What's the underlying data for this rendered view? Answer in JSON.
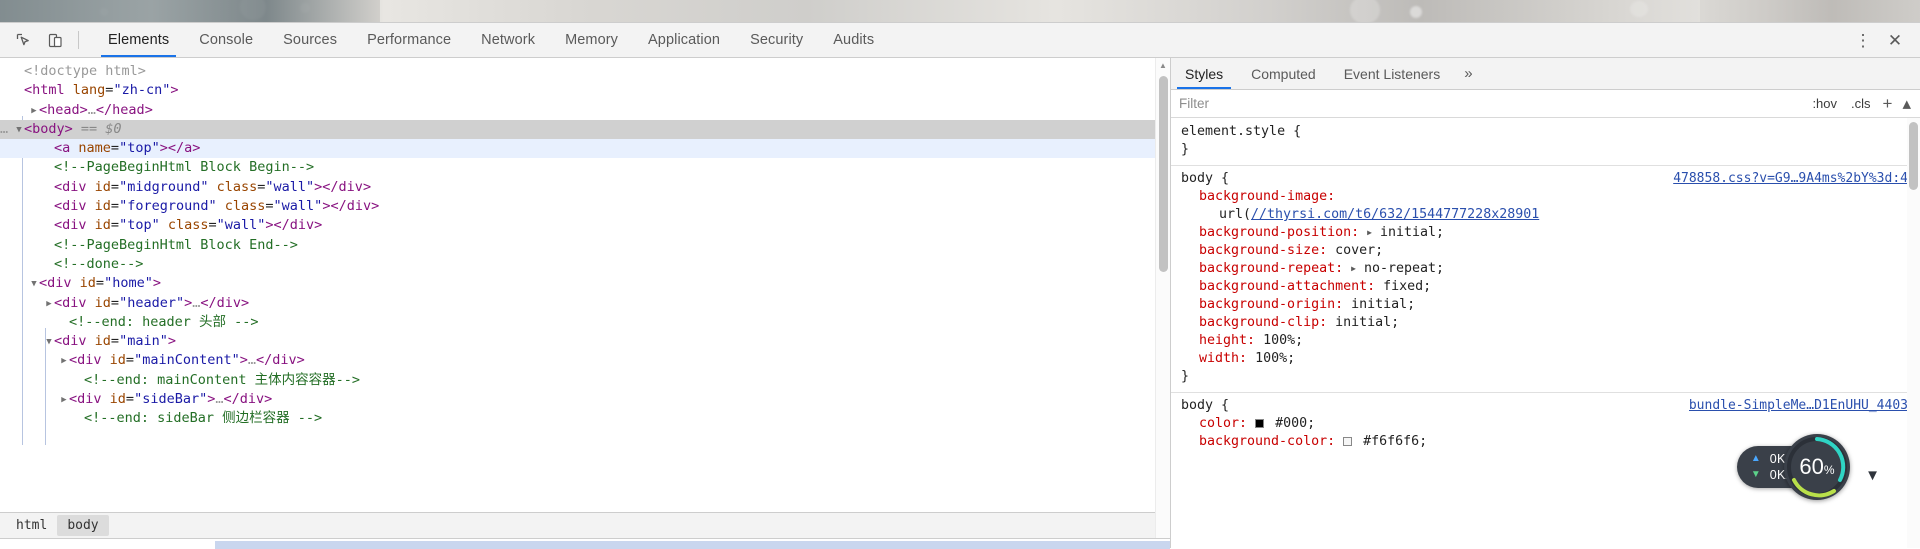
{
  "toolbar": {
    "icons": [
      {
        "name": "inspect-element-icon",
        "label": "Inspect element"
      },
      {
        "name": "device-toolbar-icon",
        "label": "Toggle device toolbar"
      }
    ],
    "tabs": [
      {
        "label": "Elements",
        "active": true
      },
      {
        "label": "Console",
        "active": false
      },
      {
        "label": "Sources",
        "active": false
      },
      {
        "label": "Performance",
        "active": false
      },
      {
        "label": "Network",
        "active": false
      },
      {
        "label": "Memory",
        "active": false
      },
      {
        "label": "Application",
        "active": false
      },
      {
        "label": "Security",
        "active": false
      },
      {
        "label": "Audits",
        "active": false
      }
    ],
    "more_label": "⋮",
    "close_label": "✕"
  },
  "dom": {
    "lines": [
      {
        "indent": 0,
        "tri": "",
        "html": "<span class=\"gray\">&lt;!doctype html&gt;</span>",
        "state": ""
      },
      {
        "indent": 0,
        "tri": "",
        "html": "<span class=\"tag\">&lt;html</span> <span class=\"attr\">lang</span>=<span class=\"val\">\"zh-cn\"</span><span class=\"tag\">&gt;</span>",
        "state": ""
      },
      {
        "indent": 1,
        "tri": "▶",
        "html": "<span class=\"tag\">&lt;head&gt;</span><span class=\"gray\">…</span><span class=\"tag\">&lt;/head&gt;</span>",
        "state": ""
      },
      {
        "indent": 0,
        "tri": "▼",
        "html": "<span class=\"tag\">&lt;body&gt;</span> <span class=\"dollar\">== $0</span>",
        "state": "sel-gray",
        "ellipsis": true
      },
      {
        "indent": 2,
        "tri": "",
        "html": "<span class=\"tag\">&lt;a</span> <span class=\"attr\">name</span>=<span class=\"val\">\"top\"</span><span class=\"tag\">&gt;&lt;/a&gt;</span>",
        "state": "sel-blue"
      },
      {
        "indent": 2,
        "tri": "",
        "html": "<span class=\"cmt\">&lt;!--PageBeginHtml Block Begin--&gt;</span>",
        "state": ""
      },
      {
        "indent": 2,
        "tri": "",
        "html": "<span class=\"tag\">&lt;div</span> <span class=\"attr\">id</span>=<span class=\"val\">\"midground\"</span> <span class=\"attr\">class</span>=<span class=\"val\">\"wall\"</span><span class=\"tag\">&gt;&lt;/div&gt;</span>",
        "state": ""
      },
      {
        "indent": 2,
        "tri": "",
        "html": "<span class=\"tag\">&lt;div</span> <span class=\"attr\">id</span>=<span class=\"val\">\"foreground\"</span> <span class=\"attr\">class</span>=<span class=\"val\">\"wall\"</span><span class=\"tag\">&gt;&lt;/div&gt;</span>",
        "state": ""
      },
      {
        "indent": 2,
        "tri": "",
        "html": "<span class=\"tag\">&lt;div</span> <span class=\"attr\">id</span>=<span class=\"val\">\"top\"</span> <span class=\"attr\">class</span>=<span class=\"val\">\"wall\"</span><span class=\"tag\">&gt;&lt;/div&gt;</span>",
        "state": ""
      },
      {
        "indent": 2,
        "tri": "",
        "html": "<span class=\"cmt\">&lt;!--PageBeginHtml Block End--&gt;</span>",
        "state": ""
      },
      {
        "indent": 2,
        "tri": "",
        "html": "<span class=\"cmt\">&lt;!--done--&gt;</span>",
        "state": ""
      },
      {
        "indent": 1,
        "tri": "▼",
        "html": "<span class=\"tag\">&lt;div</span> <span class=\"attr\">id</span>=<span class=\"val\">\"home\"</span><span class=\"tag\">&gt;</span>",
        "state": ""
      },
      {
        "indent": 2,
        "tri": "▶",
        "html": "<span class=\"tag\">&lt;div</span> <span class=\"attr\">id</span>=<span class=\"val\">\"header\"</span><span class=\"tag\">&gt;</span><span class=\"gray\">…</span><span class=\"tag\">&lt;/div&gt;</span>",
        "state": ""
      },
      {
        "indent": 3,
        "tri": "",
        "html": "<span class=\"cmt\">&lt;!--end: header 头部 --&gt;</span>",
        "state": ""
      },
      {
        "indent": 2,
        "tri": "▼",
        "html": "<span class=\"tag\">&lt;div</span> <span class=\"attr\">id</span>=<span class=\"val\">\"main\"</span><span class=\"tag\">&gt;</span>",
        "state": ""
      },
      {
        "indent": 3,
        "tri": "▶",
        "html": "<span class=\"tag\">&lt;div</span> <span class=\"attr\">id</span>=<span class=\"val\">\"mainContent\"</span><span class=\"tag\">&gt;</span><span class=\"gray\">…</span><span class=\"tag\">&lt;/div&gt;</span>",
        "state": ""
      },
      {
        "indent": 4,
        "tri": "",
        "html": "<span class=\"cmt\">&lt;!--end: mainContent 主体内容容器--&gt;</span>",
        "state": ""
      },
      {
        "indent": 3,
        "tri": "▶",
        "html": "<span class=\"tag\">&lt;div</span> <span class=\"attr\">id</span>=<span class=\"val\">\"sideBar\"</span><span class=\"tag\">&gt;</span><span class=\"gray\">…</span><span class=\"tag\">&lt;/div&gt;</span>",
        "state": ""
      },
      {
        "indent": 4,
        "tri": "",
        "html": "<span class=\"cmt\">&lt;!--end: sideBar 侧边栏容器 --&gt;</span>",
        "state": ""
      }
    ]
  },
  "breadcrumb": {
    "items": [
      {
        "label": "html",
        "active": false
      },
      {
        "label": "body",
        "active": true
      }
    ]
  },
  "styles": {
    "tabs": [
      {
        "label": "Styles",
        "active": true
      },
      {
        "label": "Computed",
        "active": false
      },
      {
        "label": "Event Listeners",
        "active": false
      }
    ],
    "overflow_label": "»",
    "filter_placeholder": "Filter",
    "hov_label": ":hov",
    "cls_label": ".cls",
    "new_rule_label": "+",
    "rules": [
      {
        "selector": "element.style {",
        "source": "",
        "declarations": [],
        "close": "}"
      },
      {
        "selector": "body {",
        "source": "478858.css?v=G9…9A4ms%2bY%3d:4",
        "declarations": [
          {
            "prop": "background-image:",
            "value": "",
            "wrap": "url(//thyrsi.com/t6/632/1544777228x28901",
            "link": true
          },
          {
            "prop": "background-position:",
            "value": "initial;",
            "expandable": true
          },
          {
            "prop": "background-size:",
            "value": "cover;"
          },
          {
            "prop": "background-repeat:",
            "value": "no-repeat;",
            "expandable": true
          },
          {
            "prop": "background-attachment:",
            "value": "fixed;"
          },
          {
            "prop": "background-origin:",
            "value": "initial;"
          },
          {
            "prop": "background-clip:",
            "value": "initial;"
          },
          {
            "prop": "height:",
            "value": "100%;"
          },
          {
            "prop": "width:",
            "value": "100%;"
          }
        ],
        "close": "}"
      },
      {
        "selector": "body {",
        "source": "bundle-SimpleMe…D1EnUHU_4403",
        "declarations": [
          {
            "prop": "color:",
            "value": "#000;",
            "swatch": "black"
          },
          {
            "prop": "background-color:",
            "value": "#f6f6f6;",
            "swatch": "white"
          }
        ],
        "close": ""
      }
    ]
  },
  "net_widget": {
    "upload": "0K/s",
    "download": "0K/s",
    "cpu_percent": "60",
    "percent_symbol": "%",
    "accent_teal": "#2fd4c4",
    "accent_lime": "#b9e04a"
  }
}
